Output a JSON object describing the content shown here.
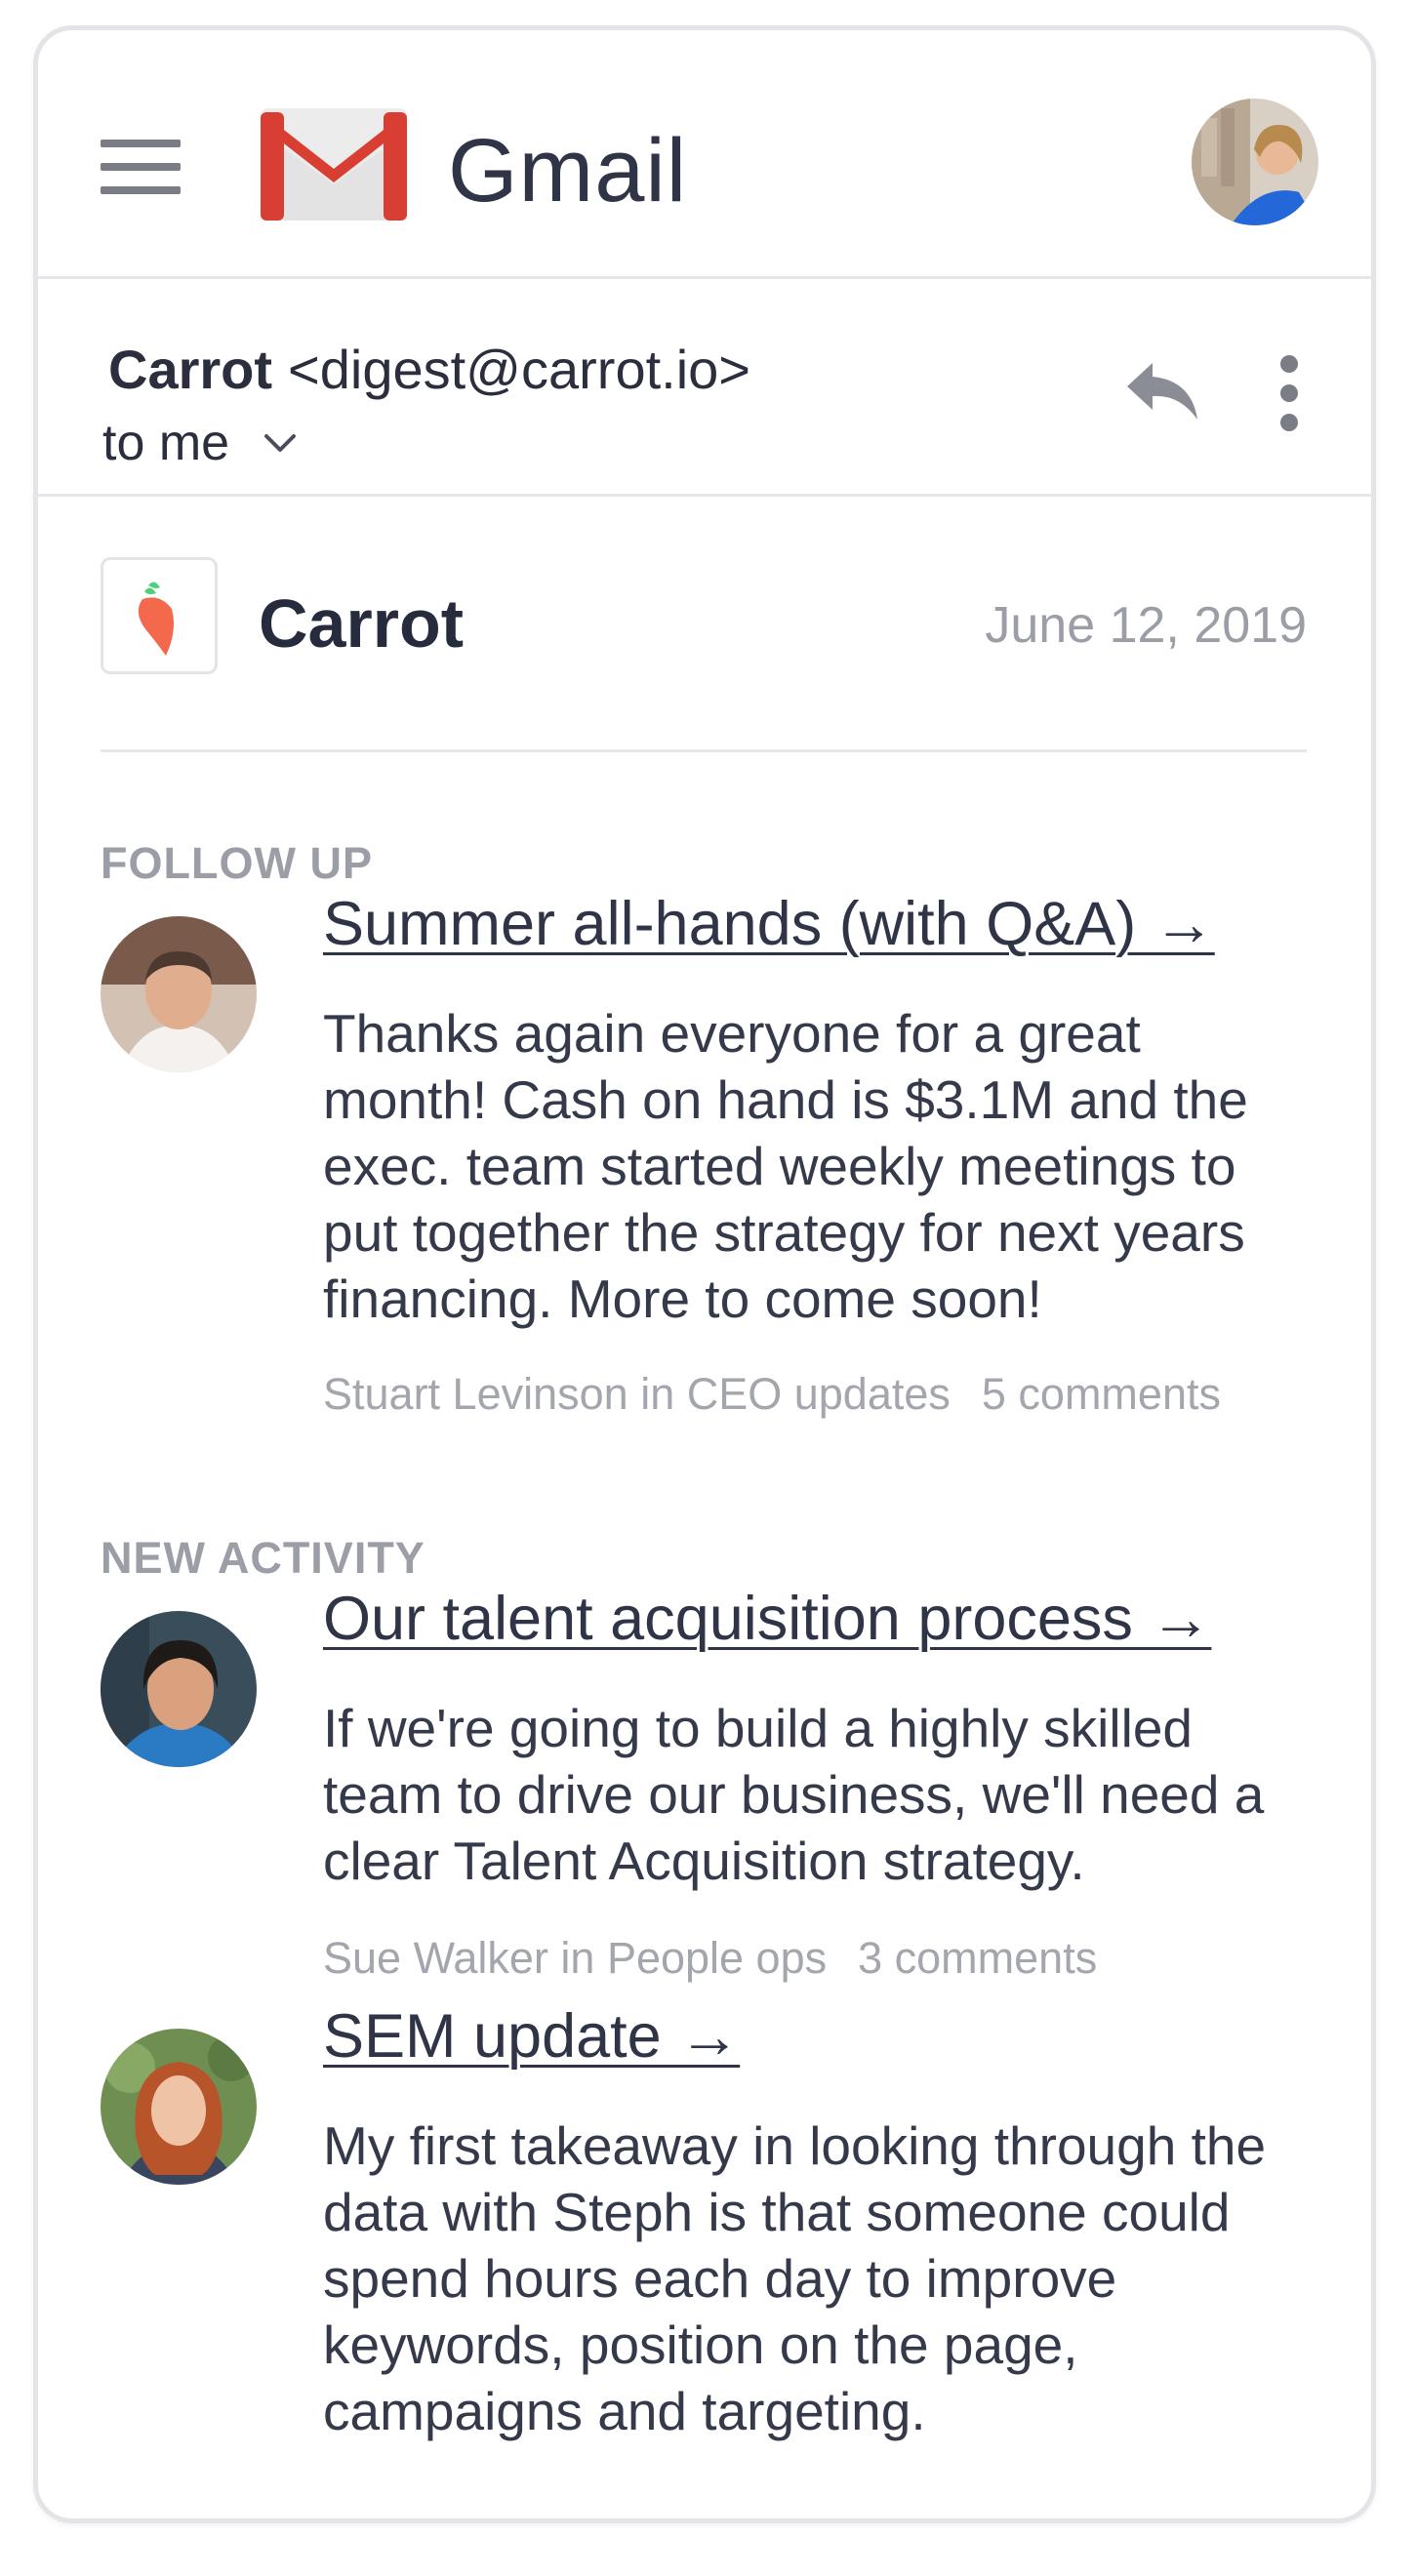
{
  "app": {
    "name": "Gmail",
    "colors": {
      "gmail_red": "#d93e33",
      "carrot_orange": "#f4684c",
      "carrot_leaf": "#4fd07c"
    }
  },
  "email": {
    "sender_name": "Carrot",
    "sender_address": "<digest@carrot.io>",
    "recipient": "to me"
  },
  "digest": {
    "brand": "Carrot",
    "date": "June 12, 2019"
  },
  "sections": [
    {
      "label": "FOLLOW UP",
      "items": [
        {
          "title": "Summer all-hands (with Q&A) →",
          "body": "Thanks again everyone for a great month! Cash on hand is $3.1M and the exec. team started weekly meetings to put together the strategy for next years financing. More to come soon!",
          "author_channel": "Stuart Levinson in CEO updates",
          "comments": "5 comments"
        }
      ]
    },
    {
      "label": "NEW ACTIVITY",
      "items": [
        {
          "title": "Our talent acquisition process →",
          "body": "If we're going to build a highly skilled team to drive our business, we'll need a clear Talent Acquisition strategy.",
          "author_channel": "Sue Walker in People ops",
          "comments": "3 comments"
        },
        {
          "title": "SEM update →",
          "body": "My first takeaway in looking through the data with Steph is that someone could spend hours each day to improve keywords, position on the page, campaigns and targeting."
        }
      ]
    }
  ]
}
